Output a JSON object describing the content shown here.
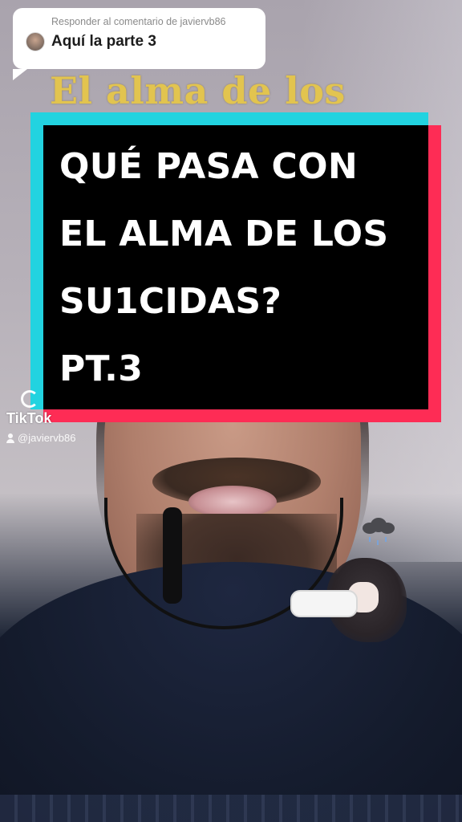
{
  "reply": {
    "header": "Responder al comentario de javiervb86",
    "text": "Aquí la parte 3"
  },
  "overlay_text": "El alma de los",
  "title": {
    "lines": [
      "QUÉ PASA CON",
      "EL ALMA DE LOS",
      "SU1CIDAS?",
      "PT.3"
    ]
  },
  "watermark": {
    "brand": "TikTok",
    "username": "@javiervb86"
  },
  "colors": {
    "cyan_accent": "#22d3e0",
    "red_accent": "#fe2c55",
    "overlay_gold": "#e2c44f"
  },
  "icons": {
    "watermark_logo": "tiktok-logo-icon",
    "user": "user-icon",
    "sticker": "sleeping-character-sticker"
  }
}
